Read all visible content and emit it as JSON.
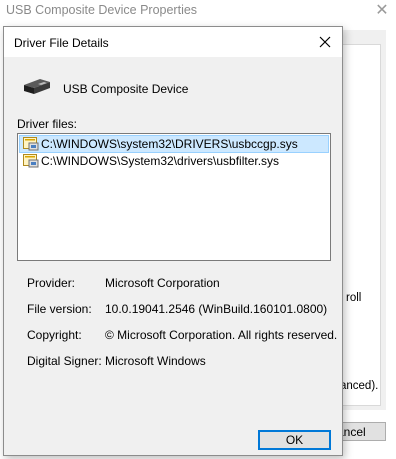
{
  "parent_window": {
    "title": "USB Composite Device Properties",
    "partial_text_1": "roll",
    "partial_text_2": "anced).",
    "cancel_label": "ancel"
  },
  "dialog": {
    "title": "Driver File Details",
    "device_name": "USB Composite Device",
    "driver_files_label": "Driver files:",
    "files": [
      {
        "path": "C:\\WINDOWS\\system32\\DRIVERS\\usbccgp.sys",
        "selected": true
      },
      {
        "path": "C:\\WINDOWS\\System32\\drivers\\usbfilter.sys",
        "selected": false
      }
    ],
    "details": {
      "provider_label": "Provider:",
      "provider_value": "Microsoft Corporation",
      "file_version_label": "File version:",
      "file_version_value": "10.0.19041.2546 (WinBuild.160101.0800)",
      "copyright_label": "Copyright:",
      "copyright_value": "© Microsoft Corporation. All rights reserved.",
      "digital_signer_label": "Digital Signer:",
      "digital_signer_value": "Microsoft Windows"
    },
    "ok_label": "OK"
  },
  "colors": {
    "selection": "#cce8ff",
    "accent": "#0078d7",
    "dialog_bg": "#f0f0f0"
  }
}
